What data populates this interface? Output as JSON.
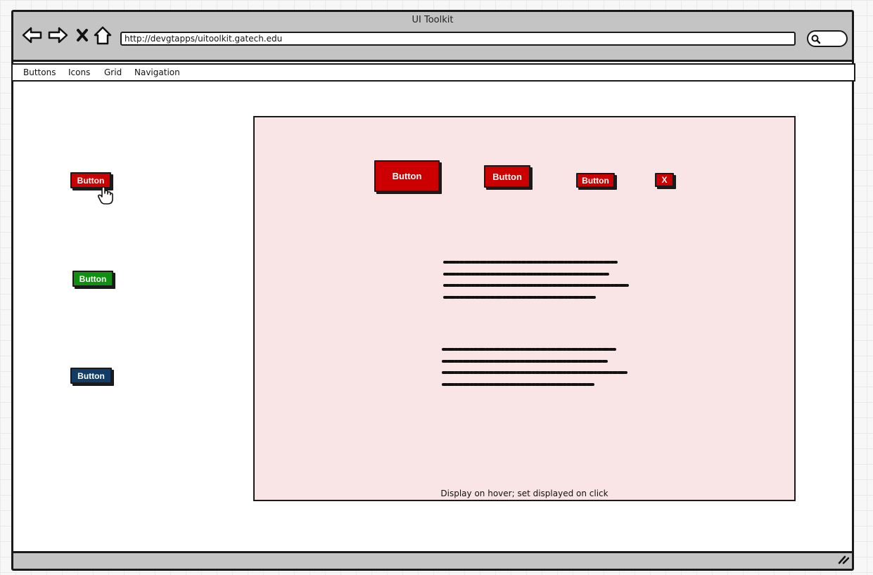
{
  "window": {
    "title": "UI Toolkit",
    "url": "http://devgtapps/uitoolkit.gatech.edu"
  },
  "nav_icons": [
    "back-arrow-icon",
    "forward-arrow-icon",
    "stop-icon",
    "home-icon",
    "search-icon"
  ],
  "menu": {
    "items": [
      {
        "label": "Buttons"
      },
      {
        "label": "Icons"
      },
      {
        "label": "Grid"
      },
      {
        "label": "Navigation"
      }
    ]
  },
  "sidebar_buttons": [
    {
      "label": "Button",
      "color": "#cc0000",
      "state": "hovered"
    },
    {
      "label": "Button",
      "color": "#109010"
    },
    {
      "label": "Button",
      "color": "#123c66"
    }
  ],
  "panel": {
    "buttons": [
      {
        "label": "Button",
        "size": "large"
      },
      {
        "label": "Button",
        "size": "medium"
      },
      {
        "label": "Button",
        "size": "small"
      },
      {
        "label": "X",
        "size": "icon"
      }
    ],
    "caption": "Display on hover; set displayed on click"
  },
  "colors": {
    "chrome": "#c4c4c4",
    "panel_bg": "#f9e5e5",
    "accent_red": "#cc0000",
    "accent_green": "#109010",
    "accent_navy": "#123c66"
  }
}
